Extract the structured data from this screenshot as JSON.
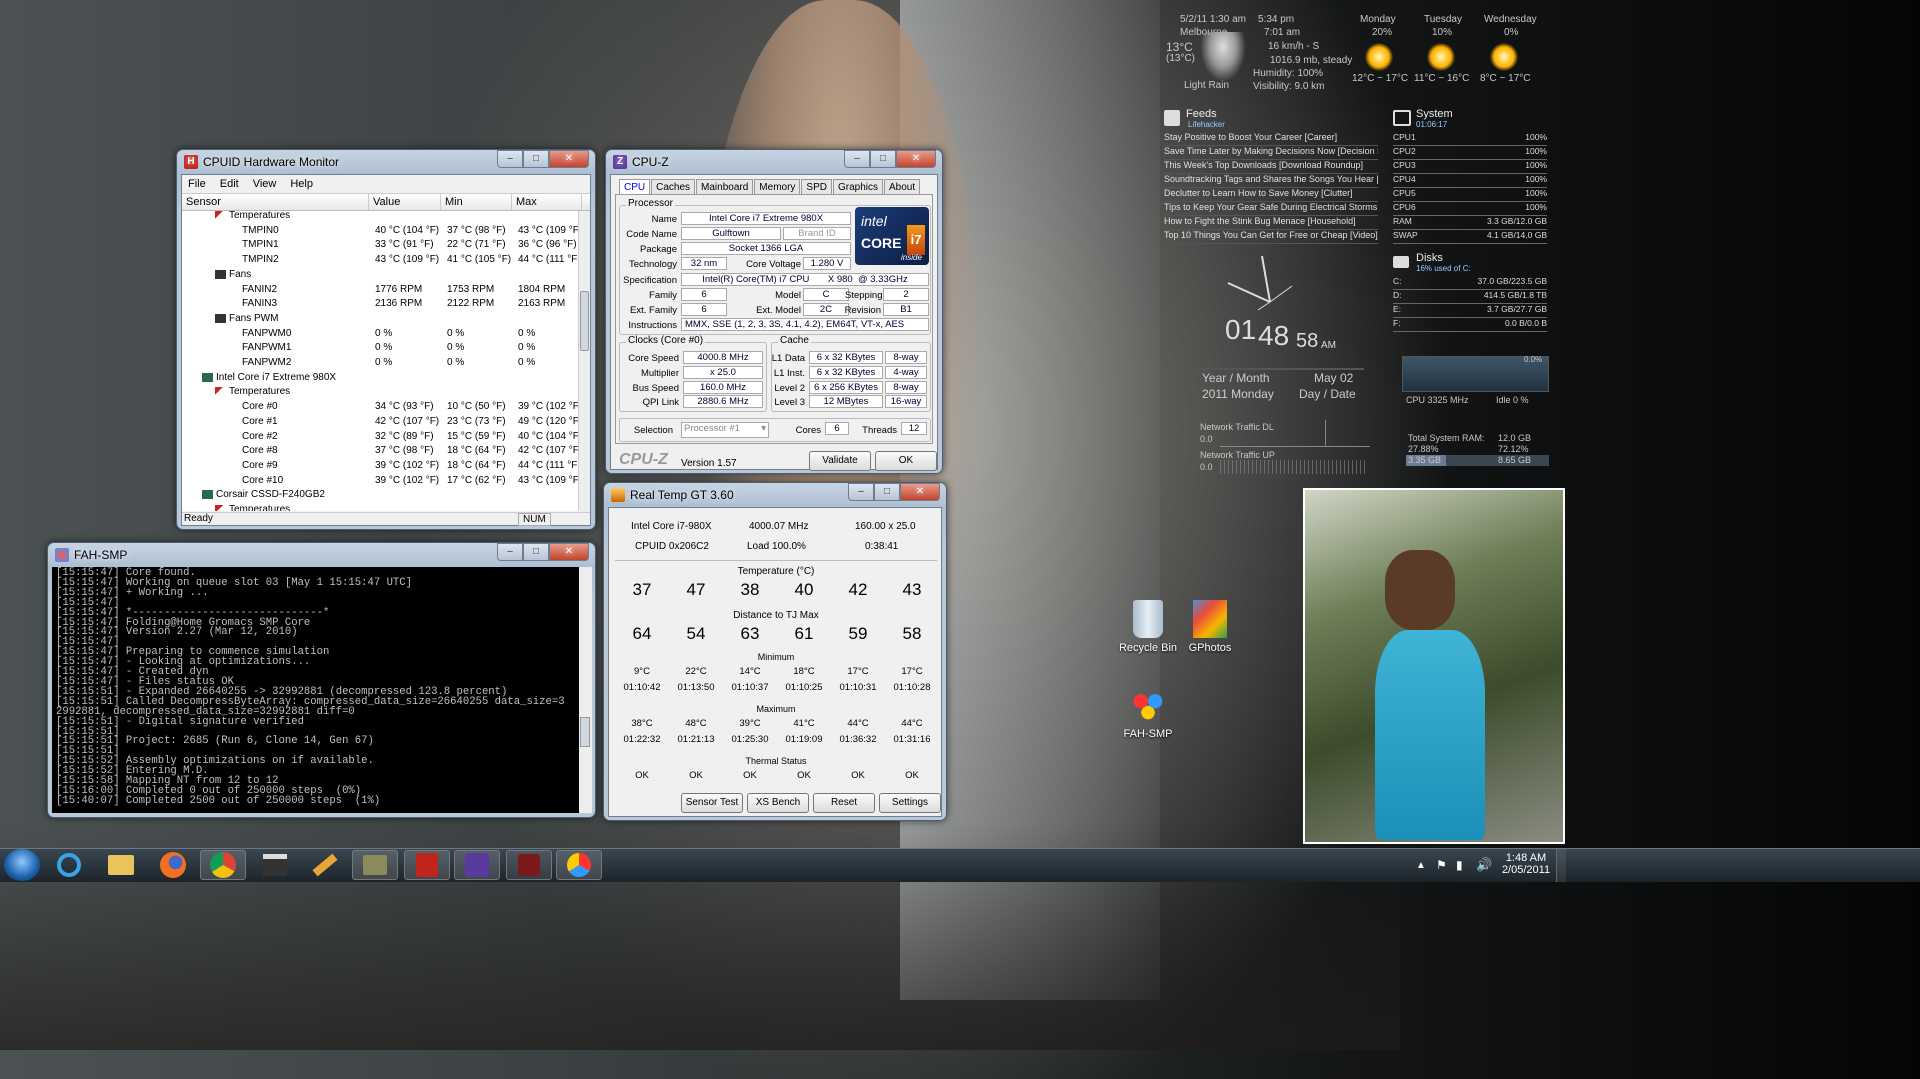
{
  "hwmon": {
    "title": "CPUID Hardware Monitor",
    "menu": [
      "File",
      "Edit",
      "View",
      "Help"
    ],
    "columns": [
      "Sensor",
      "Value",
      "Min",
      "Max"
    ],
    "rows": [
      {
        "name": "Temperatures",
        "indent": 3,
        "kind": "group"
      },
      {
        "name": "TMPIN0",
        "indent": 4,
        "value": "40 °C (104 °F)",
        "min": "37 °C (98 °F)",
        "max": "43 °C (109 °F"
      },
      {
        "name": "TMPIN1",
        "indent": 4,
        "value": "33 °C (91 °F)",
        "min": "22 °C (71 °F)",
        "max": "36 °C (96 °F)"
      },
      {
        "name": "TMPIN2",
        "indent": 4,
        "value": "43 °C (109 °F)",
        "min": "41 °C (105 °F)",
        "max": "44 °C (111 °F"
      },
      {
        "name": "Fans",
        "indent": 3,
        "kind": "group"
      },
      {
        "name": "FANIN2",
        "indent": 4,
        "value": "1776 RPM",
        "min": "1753 RPM",
        "max": "1804 RPM"
      },
      {
        "name": "FANIN3",
        "indent": 4,
        "value": "2136 RPM",
        "min": "2122 RPM",
        "max": "2163 RPM"
      },
      {
        "name": "Fans PWM",
        "indent": 3,
        "kind": "group"
      },
      {
        "name": "FANPWM0",
        "indent": 4,
        "value": "0 %",
        "min": "0 %",
        "max": "0 %"
      },
      {
        "name": "FANPWM1",
        "indent": 4,
        "value": "0 %",
        "min": "0 %",
        "max": "0 %"
      },
      {
        "name": "FANPWM2",
        "indent": 4,
        "value": "0 %",
        "min": "0 %",
        "max": "0 %"
      },
      {
        "name": "Intel Core i7 Extreme 980X",
        "indent": 2,
        "kind": "device"
      },
      {
        "name": "Temperatures",
        "indent": 3,
        "kind": "group"
      },
      {
        "name": "Core #0",
        "indent": 4,
        "value": "34 °C (93 °F)",
        "min": "10 °C (50 °F)",
        "max": "39 °C (102 °F"
      },
      {
        "name": "Core #1",
        "indent": 4,
        "value": "42 °C (107 °F)",
        "min": "23 °C (73 °F)",
        "max": "49 °C (120 °F"
      },
      {
        "name": "Core #2",
        "indent": 4,
        "value": "32 °C (89 °F)",
        "min": "15 °C (59 °F)",
        "max": "40 °C (104 °F"
      },
      {
        "name": "Core #8",
        "indent": 4,
        "value": "37 °C (98 °F)",
        "min": "18 °C (64 °F)",
        "max": "42 °C (107 °F"
      },
      {
        "name": "Core #9",
        "indent": 4,
        "value": "39 °C (102 °F)",
        "min": "18 °C (64 °F)",
        "max": "44 °C (111 °F"
      },
      {
        "name": "Core #10",
        "indent": 4,
        "value": "39 °C (102 °F)",
        "min": "17 °C (62 °F)",
        "max": "43 °C (109 °F"
      },
      {
        "name": "Corsair CSSD-F240GB2",
        "indent": 2,
        "kind": "device"
      },
      {
        "name": "Temperatures",
        "indent": 3,
        "kind": "group"
      }
    ],
    "status": "Ready",
    "num": "NUM"
  },
  "fah": {
    "title": "FAH-SMP",
    "lines": [
      "[15:15:47] Core found.",
      "[15:15:47] Working on queue slot 03 [May 1 15:15:47 UTC]",
      "[15:15:47] + Working ...",
      "[15:15:47]",
      "[15:15:47] *------------------------------*",
      "[15:15:47] Folding@Home Gromacs SMP Core",
      "[15:15:47] Version 2.27 (Mar 12, 2010)",
      "[15:15:47]",
      "[15:15:47] Preparing to commence simulation",
      "[15:15:47] - Looking at optimizations...",
      "[15:15:47] - Created dyn",
      "[15:15:47] - Files status OK",
      "[15:15:51] - Expanded 26640255 -> 32992881 (decompressed 123.8 percent)",
      "[15:15:51] Called DecompressByteArray: compressed_data_size=26640255 data_size=3",
      "2992881, decompressed_data_size=32992881 diff=0",
      "[15:15:51] - Digital signature verified",
      "[15:15:51]",
      "[15:15:51] Project: 2685 (Run 6, Clone 14, Gen 67)",
      "[15:15:51]",
      "[15:15:52] Assembly optimizations on if available.",
      "[15:15:52] Entering M.D.",
      "[15:15:58] Mapping NT from 12 to 12",
      "[15:16:00] Completed 0 out of 250000 steps  (0%)",
      "[15:40:07] Completed 2500 out of 250000 steps  (1%)"
    ]
  },
  "cpuz": {
    "title": "CPU-Z",
    "tabs": [
      "CPU",
      "Caches",
      "Mainboard",
      "Memory",
      "SPD",
      "Graphics",
      "About"
    ],
    "processor_label": "Processor",
    "name_l": "Name",
    "name": "Intel Core i7 Extreme 980X",
    "codename_l": "Code Name",
    "codename": "Gulftown",
    "brandid_l": "Brand ID",
    "package_l": "Package",
    "package": "Socket 1366 LGA",
    "tech_l": "Technology",
    "tech": "32 nm",
    "cv_l": "Core Voltage",
    "cv": "1.280 V",
    "spec_l": "Specification",
    "spec": "Intel(R) Core(TM) i7 CPU       X 980  @ 3.33GHz",
    "family_l": "Family",
    "family": "6",
    "model_l": "Model",
    "model": "C",
    "stepping_l": "Stepping",
    "stepping": "2",
    "extfam_l": "Ext. Family",
    "extfam": "6",
    "extmodel_l": "Ext. Model",
    "extmodel": "2C",
    "rev_l": "Revision",
    "rev": "B1",
    "instr_l": "Instructions",
    "instr": "MMX, SSE (1, 2, 3, 3S, 4.1, 4.2), EM64T, VT-x, AES",
    "clocks_label": "Clocks (Core #0)",
    "corespeed_l": "Core Speed",
    "corespeed": "4000.8 MHz",
    "mult_l": "Multiplier",
    "mult": "x 25.0",
    "bus_l": "Bus Speed",
    "bus": "160.0 MHz",
    "qpi_l": "QPI Link",
    "qpi": "2880.6 MHz",
    "cache_label": "Cache",
    "l1d_l": "L1 Data",
    "l1d": "6 x 32 KBytes",
    "l1d_w": "8-way",
    "l1i_l": "L1 Inst.",
    "l1i": "6 x 32 KBytes",
    "l1i_w": "4-way",
    "l2_l": "Level 2",
    "l2": "6 x 256 KBytes",
    "l2_w": "8-way",
    "l3_l": "Level 3",
    "l3": "12 MBytes",
    "l3_w": "16-way",
    "sel_l": "Selection",
    "sel": "Processor #1",
    "cores_l": "Cores",
    "cores": "6",
    "threads_l": "Threads",
    "threads": "12",
    "brand": "CPU-Z",
    "version": "Version 1.57",
    "validate": "Validate",
    "ok": "OK",
    "logo_intel": "intel",
    "logo_core": "CORE",
    "logo_i7": "i7",
    "logo_inside": "inside"
  },
  "realtemp": {
    "title": "Real Temp GT 3.60",
    "cpu": "Intel Core i7-980X",
    "freq": "4000.07 MHz",
    "ratio": "160.00 x 25.0",
    "cpuid": "CPUID  0x206C2",
    "load": "Load 100.0%",
    "time": "0:38:41",
    "temp_label": "Temperature (°C)",
    "temps": [
      "37",
      "47",
      "38",
      "40",
      "42",
      "43"
    ],
    "tj_label": "Distance to TJ Max",
    "tj": [
      "64",
      "54",
      "63",
      "61",
      "59",
      "58"
    ],
    "min_label": "Minimum",
    "min_t": [
      "9°C",
      "22°C",
      "14°C",
      "18°C",
      "17°C",
      "17°C"
    ],
    "min_time": [
      "01:10:42",
      "01:13:50",
      "01:10:37",
      "01:10:25",
      "01:10:31",
      "01:10:28"
    ],
    "max_label": "Maximum",
    "max_t": [
      "38°C",
      "48°C",
      "39°C",
      "41°C",
      "44°C",
      "44°C"
    ],
    "max_time": [
      "01:22:32",
      "01:21:13",
      "01:25:30",
      "01:19:09",
      "01:36:32",
      "01:31:16"
    ],
    "thermal_label": "Thermal Status",
    "status": [
      "OK",
      "OK",
      "OK",
      "OK",
      "OK",
      "OK"
    ],
    "buttons": [
      "Sensor Test",
      "XS Bench",
      "Reset",
      "Settings"
    ]
  },
  "weather": {
    "date": "5/2/11 1:30 am",
    "city": "Melbourne",
    "temp": "13°C",
    "feels": "(13°C)",
    "cond": "Light Rain",
    "sunset": "5:34 pm",
    "sunrise": "7:01 am",
    "wind": "16 km/h - S",
    "pressure": "1016.9 mb, steady",
    "humidity": "Humidity: 100%",
    "visibility": "Visibility: 9.0 km",
    "days": [
      {
        "d": "Monday",
        "p": "20%",
        "r": "12°C ~ 17°C"
      },
      {
        "d": "Tuesday",
        "p": "10%",
        "r": "11°C ~ 16°C"
      },
      {
        "d": "Wednesday",
        "p": "0%",
        "r": "8°C ~ 17°C"
      }
    ]
  },
  "feeds": {
    "title": "Feeds",
    "source": "Lifehacker",
    "items": [
      "Stay Positive to Boost Your Career [Career]",
      "Save Time Later by Making Decisions Now [Decision Making]",
      "This Week's Top Downloads [Download Roundup]",
      "Soundtracking Tags and Shares the Songs You Hear [Down...",
      "Declutter to Learn How to Save Money [Clutter]",
      "Tips to Keep Your Gear Safe During Electrical Storms [Safety]",
      "How to Fight the Stink Bug Menace [Household]",
      "Top 10 Things You Can Get for Free or Cheap [Video]"
    ]
  },
  "system": {
    "title": "System",
    "uptime": "01:06:17",
    "rows": [
      [
        "CPU1",
        "100%"
      ],
      [
        "CPU2",
        "100%"
      ],
      [
        "CPU3",
        "100%"
      ],
      [
        "CPU4",
        "100%"
      ],
      [
        "CPU5",
        "100%"
      ],
      [
        "CPU6",
        "100%"
      ],
      [
        "RAM",
        "3.3 GB/12.0 GB"
      ],
      [
        "SWAP",
        "4.1 GB/14.0 GB"
      ]
    ]
  },
  "disks": {
    "title": "Disks",
    "sub": "16% used of C:",
    "rows": [
      [
        "C:",
        "37.0 GB/223.5 GB"
      ],
      [
        "D:",
        "414.5 GB/1.8 TB"
      ],
      [
        "E:",
        "3.7 GB/27.7 GB"
      ],
      [
        "F:",
        "0.0 B/0.0 B"
      ]
    ]
  },
  "clock": {
    "h": "01",
    "m": "48",
    "s": "58",
    "ampm": "AM",
    "ym": "Year / Month",
    "md": "May 02",
    "yd": "2011 Monday",
    "dd": "Day / Date"
  },
  "cpugraph": {
    "pct": "0.0%",
    "mhz": "CPU 3325 MHz",
    "idle": "Idle 0 %",
    "ram_l": "Total System RAM:",
    "ram": "12.0 GB",
    "p1": "27.88%",
    "p2": "72.12%",
    "u1": "3.35 GB",
    "u2": "8.65 GB"
  },
  "net": {
    "dl": "Network Traffic DL",
    "dl_v": "0.0",
    "ul": "Network Traffic UP",
    "ul_v": "0.0"
  },
  "icons": {
    "recycle": "Recycle Bin",
    "gphotos": "GPhotos",
    "fah": "FAH-SMP"
  },
  "tray": {
    "time": "1:48 AM",
    "date": "2/05/2011"
  }
}
